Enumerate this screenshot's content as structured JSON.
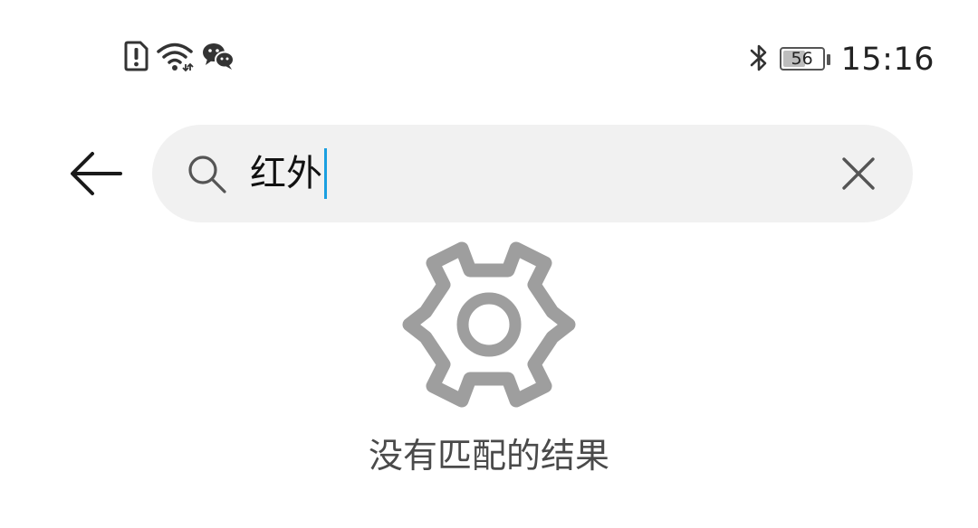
{
  "status_bar": {
    "left_icons": [
      "sim-alert-icon",
      "wifi-icon",
      "wechat-icon"
    ],
    "bluetooth_icon": "bluetooth-icon",
    "battery_level": 56,
    "battery_text": "56",
    "time": "15:16"
  },
  "search": {
    "back_icon": "arrow-left-icon",
    "search_icon": "search-icon",
    "query": "红外",
    "clear_icon": "close-icon",
    "caret_color": "#1a9fe0",
    "box_color": "#f1f1f1"
  },
  "empty_state": {
    "icon": "gear-icon",
    "icon_color": "#9e9e9e",
    "message": "没有匹配的结果"
  }
}
